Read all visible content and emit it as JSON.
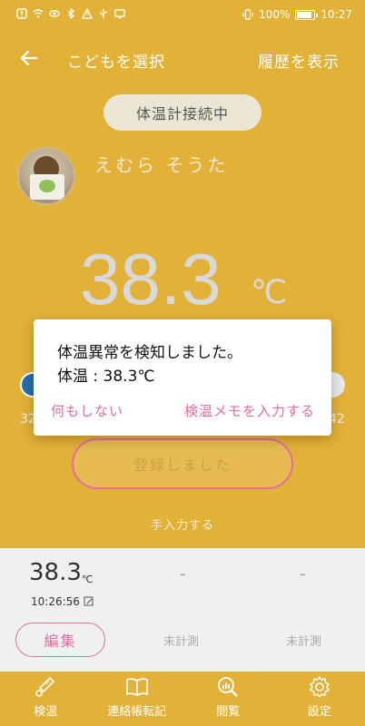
{
  "status_bar": {
    "battery": "100%",
    "time": "10:27"
  },
  "header": {
    "title": "こどもを選択",
    "history": "履歴を表示"
  },
  "connection": {
    "label": "体温計接続中"
  },
  "child": {
    "name": "えむら そうた"
  },
  "reading": {
    "value": "38.3",
    "unit": "℃"
  },
  "range": {
    "min": "32",
    "max": "42"
  },
  "actions": {
    "register": "登録しました",
    "manual": "手入力する"
  },
  "record": {
    "temp": "38.3",
    "unit": "℃",
    "time": "10:26:56",
    "slot2": "-",
    "slot3": "-",
    "edit": "編集",
    "unmeasured2": "未計測",
    "unmeasured3": "未計測"
  },
  "tabs": [
    {
      "label": "検温",
      "icon": "thermometer-icon"
    },
    {
      "label": "連絡帳転記",
      "icon": "book-icon"
    },
    {
      "label": "閲覧",
      "icon": "chart-search-icon"
    },
    {
      "label": "設定",
      "icon": "gear-icon"
    }
  ],
  "dialog": {
    "title": "体温異常を検知しました。",
    "body": "体温 : 38.3℃",
    "do_nothing": "何もしない",
    "enter_memo": "検温メモを入力する"
  },
  "colors": {
    "primary": "#e2b137",
    "accent": "#e56ca1"
  }
}
